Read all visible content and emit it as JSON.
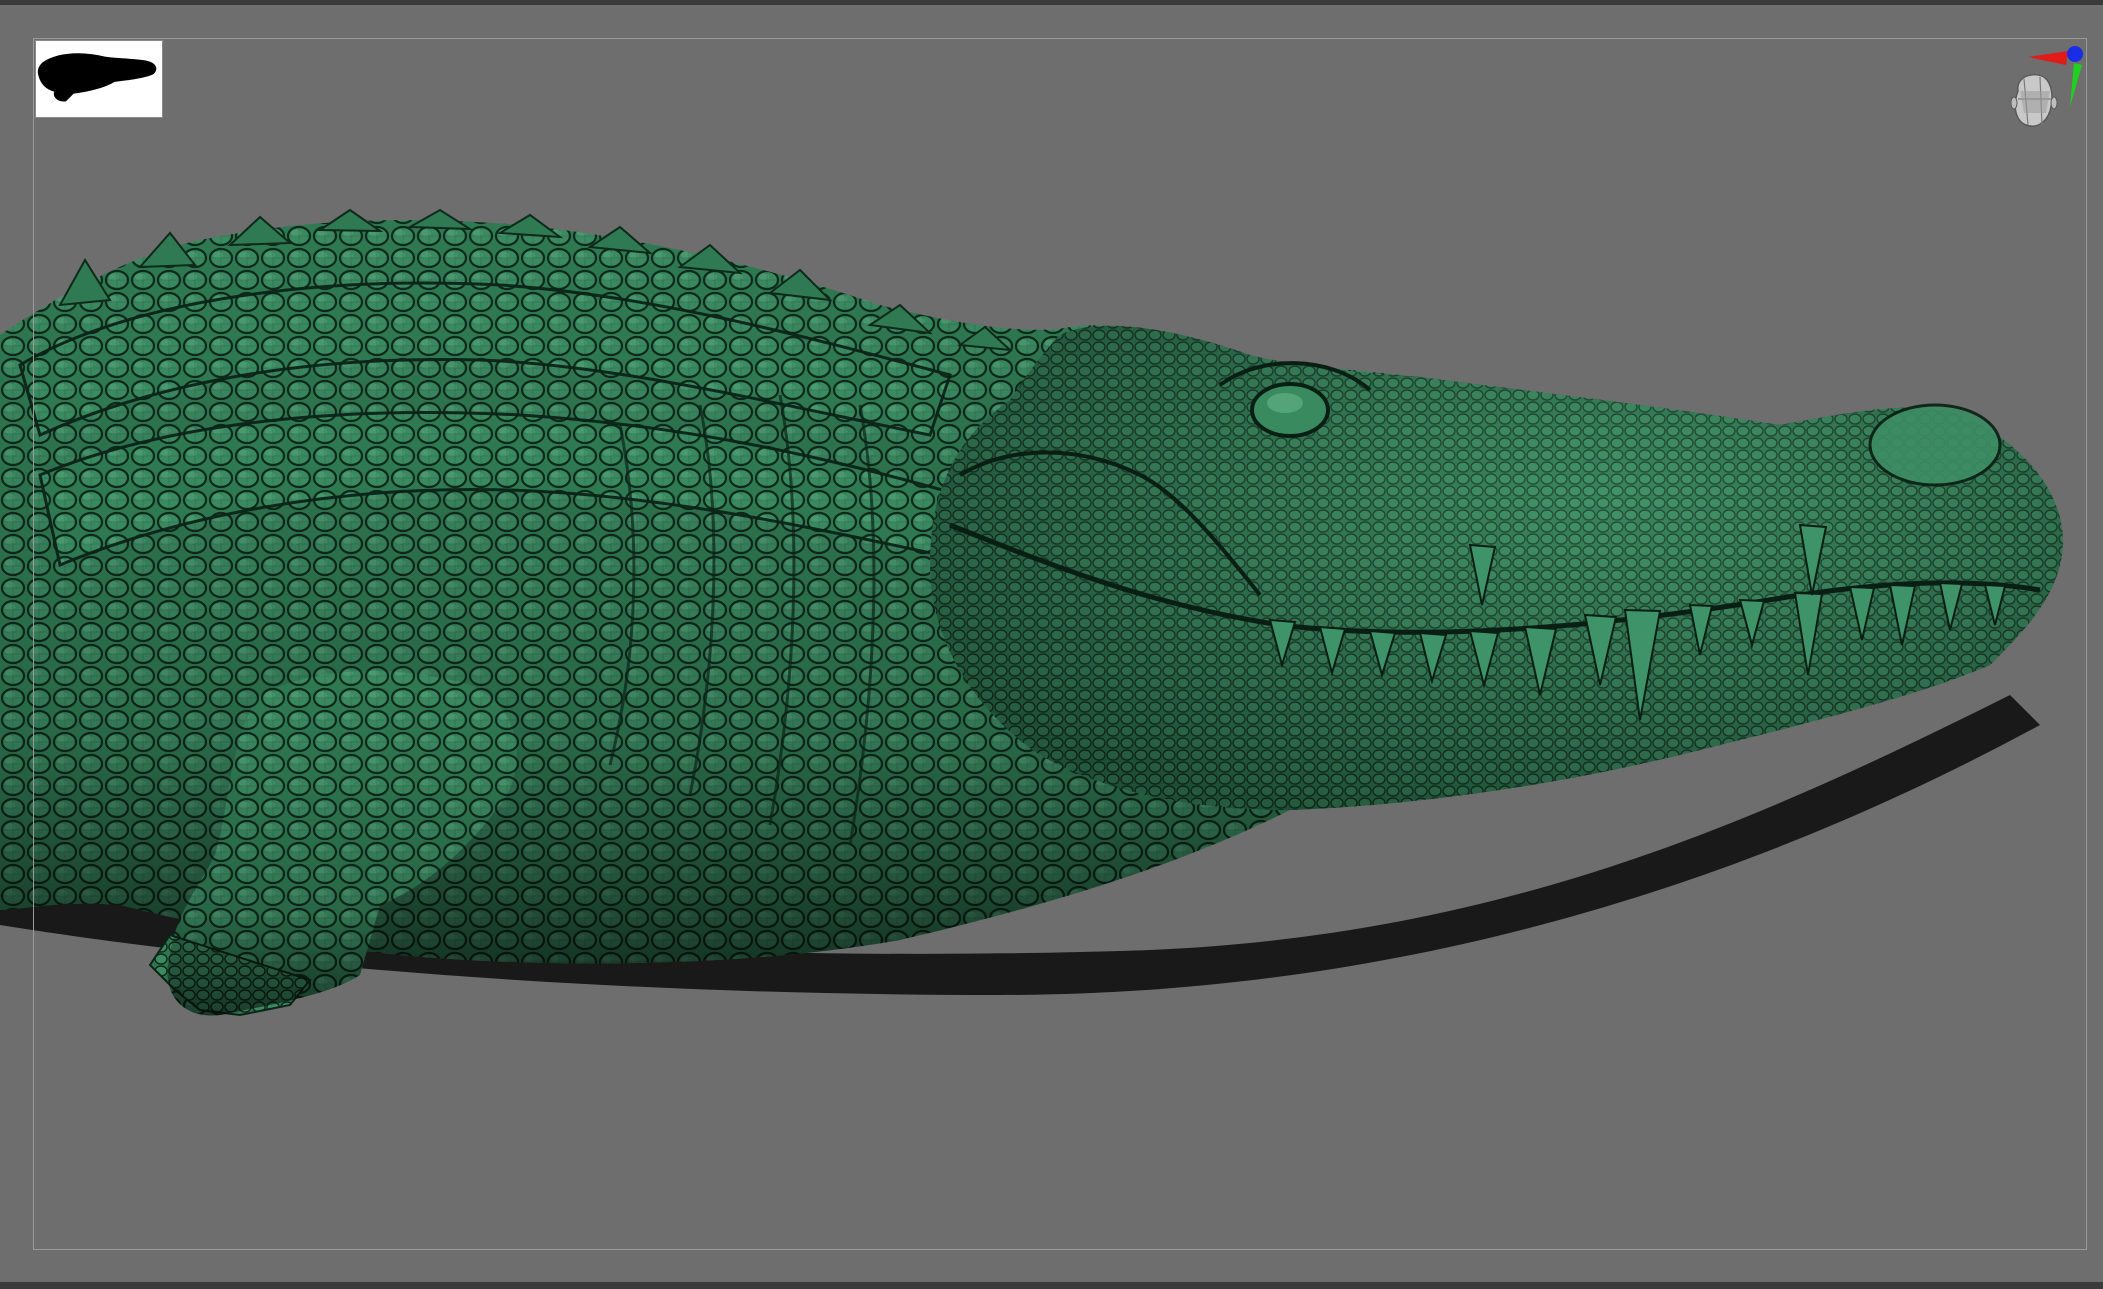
{
  "app": {
    "window_title": "",
    "canvas_background": "#6e6e6e",
    "frame_border_color": "#9a9a9a"
  },
  "navigator": {
    "icon": "navigator-thumbnail-icon",
    "background": "#ffffff",
    "silhouette_color": "#000000"
  },
  "gyro": {
    "icon": "axis-gizmo-icon",
    "x_axis_color": "#e11a1a",
    "y_axis_color": "#1fd11f",
    "z_axis_color": "#1a2de6",
    "head_icon": "orientation-head-icon"
  },
  "model": {
    "subject": "crocodile-sculpt",
    "material_color": "#2f7a52",
    "wireframe_visible": true
  }
}
